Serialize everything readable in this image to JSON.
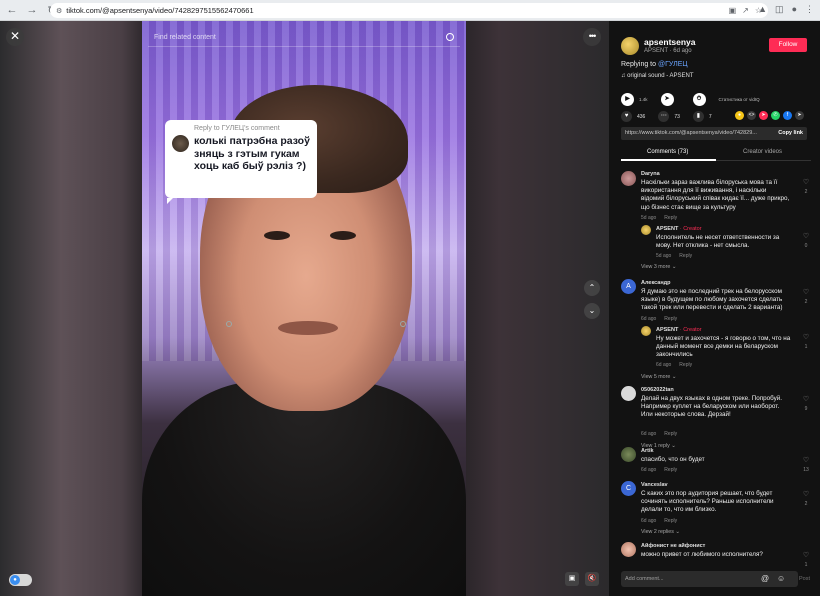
{
  "browser": {
    "url": "tiktok.com/@apsentsenya/video/7428297515562470661",
    "back_icon": "arrow-left",
    "forward_icon": "arrow-right",
    "reload_icon": "reload"
  },
  "video": {
    "search_placeholder": "Find related content",
    "reply_header": "Reply to ГУЛЕЦ's comment",
    "reply_text": "колькі патрэбна разоў зняць з гэтым гукам хоць каб быў рэліз ?)"
  },
  "author": {
    "username": "apsentsenya",
    "display_name": "APSENT",
    "time": "6d ago",
    "follow_label": "Follow",
    "replying_to_prefix": "Replying to",
    "replying_to_mention": "@ГУЛЕЦ",
    "sound": "original sound - APSENT"
  },
  "stats": {
    "plays_label": "1.4k",
    "likes": "436",
    "comments": "73",
    "saves": "7",
    "extra_label": "Статистика от vidIQ",
    "link": "https://www.tiktok.com/@apsentsenya/video/742829...",
    "copy_label": "Copy link"
  },
  "tabs": {
    "comments": "Comments (73)",
    "creator": "Creator videos"
  },
  "comments": [
    {
      "name": "Daryna",
      "text": "Наскільки зараз важлива білоруська мова та її використання для її виживання, і наскільки відомий білоруський співак кидає її... дуже прикро, що бізнес стає вище за культуру",
      "time": "5d ago",
      "reply": "Reply",
      "likes": "2"
    },
    {
      "name": "APSENT",
      "badge": "· Creator",
      "text": "Исполнитель не несет ответственности за мову. Нет отклика - нет смысла.",
      "time": "5d ago",
      "reply": "Reply",
      "likes": "0",
      "more": "View 3 more"
    },
    {
      "name": "Александр",
      "text": "Я думаю это не последний трек на белорусском языке) в будущем по любому захочется сделать такой трек или перевести и сделать 2 варианта)",
      "time": "6d ago",
      "reply": "Reply",
      "likes": "2"
    },
    {
      "name": "APSENT",
      "badge": "· Creator",
      "text": "Ну может и захочется - я говорю о том, что на данный момент все демки на беларуском закончились",
      "time": "6d ago",
      "reply": "Reply",
      "likes": "1",
      "more": "View 5 more"
    },
    {
      "name": "05062022tan",
      "text": "Делай на двух языках в одном треке. Попробуй. Например куплет на беларуском или наоборот. Или некоторые слова. Дерзай!",
      "time": "6d ago",
      "reply": "Reply",
      "likes": "9",
      "more": "View 1 reply"
    },
    {
      "name": "Artik",
      "text": "спасибо, что он будет",
      "time": "6d ago",
      "reply": "Reply",
      "likes": "13"
    },
    {
      "name": "Vanceslav",
      "text": "С каких это пор аудитория решает, что будет сочинять исполнитель? Раньше исполнители делали то, что им близко.",
      "time": "6d ago",
      "reply": "Reply",
      "likes": "2",
      "more": "View 2 replies"
    },
    {
      "name": "Айфонист не айфонист",
      "text": "можно привет от любимого исполнителя?",
      "time": "6d ago",
      "reply": "Reply",
      "likes": "1"
    }
  ],
  "add_comment": {
    "placeholder": "Add comment...",
    "post_label": "Post"
  },
  "colors": {
    "accent": "#fe2c55",
    "mention": "#6aa4ff",
    "panel_bg": "#121212"
  }
}
